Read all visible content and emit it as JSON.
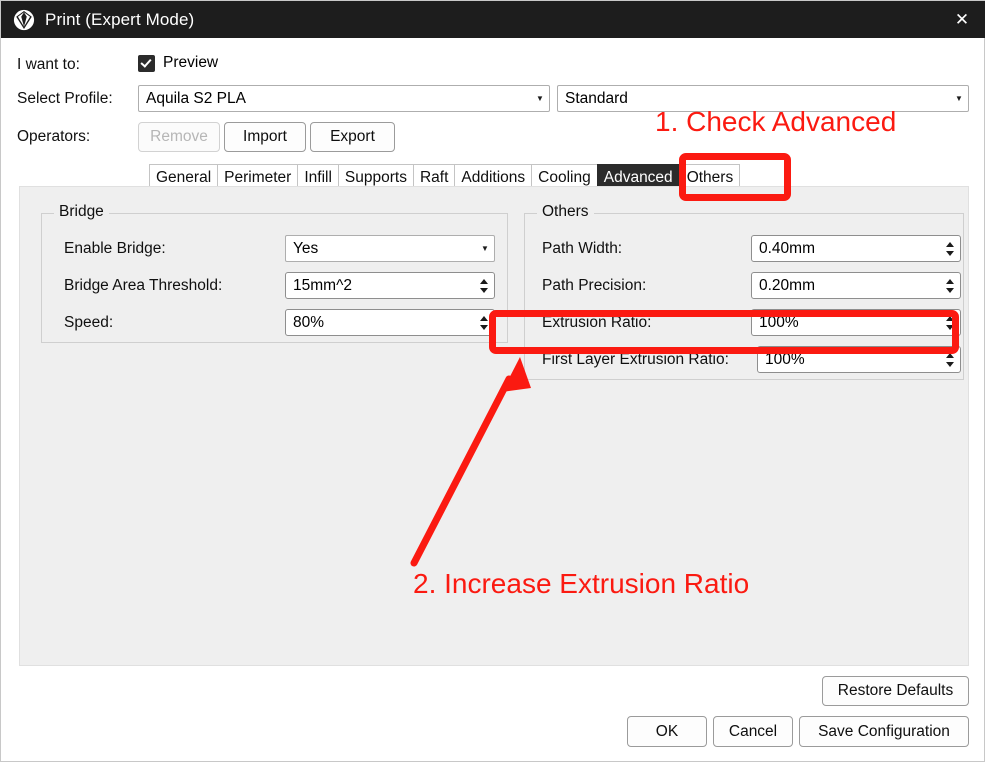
{
  "window": {
    "title": "Print (Expert Mode)",
    "app_icon": "gem-icon",
    "close_icon": "✕"
  },
  "header": {
    "i_want_to_label": "I want to:",
    "preview_label": "Preview",
    "preview_checked": true,
    "select_profile_label": "Select Profile:",
    "profile_value": "Aquila S2 PLA",
    "quality_value": "Standard",
    "operators_label": "Operators:",
    "buttons": [
      {
        "label": "Remove",
        "disabled": true
      },
      {
        "label": "Import",
        "disabled": false
      },
      {
        "label": "Export",
        "disabled": false
      }
    ]
  },
  "tabs": [
    {
      "label": "General",
      "active": false
    },
    {
      "label": "Perimeter",
      "active": false
    },
    {
      "label": "Infill",
      "active": false
    },
    {
      "label": "Supports",
      "active": false
    },
    {
      "label": "Raft",
      "active": false
    },
    {
      "label": "Additions",
      "active": false
    },
    {
      "label": "Cooling",
      "active": false
    },
    {
      "label": "Advanced",
      "active": true
    },
    {
      "label": "Others",
      "active": false
    }
  ],
  "bridge_group": {
    "title": "Bridge",
    "enable_bridge_label": "Enable Bridge:",
    "enable_bridge_value": "Yes",
    "area_threshold_label": "Bridge Area Threshold:",
    "area_threshold_value": "15mm^2",
    "speed_label": "Speed:",
    "speed_value": "80%"
  },
  "others_group": {
    "title": "Others",
    "path_width_label": "Path Width:",
    "path_width_value": "0.40mm",
    "path_precision_label": "Path Precision:",
    "path_precision_value": "0.20mm",
    "extrusion_ratio_label": "Extrusion Ratio:",
    "extrusion_ratio_value": "100%",
    "first_layer_label": "First Layer Extrusion Ratio:",
    "first_layer_value": "100%"
  },
  "footer": {
    "restore_defaults": "Restore Defaults",
    "ok": "OK",
    "cancel": "Cancel",
    "save_configuration": "Save Configuration"
  },
  "annotations": {
    "color": "#fb1a11",
    "step1": "1. Check Advanced",
    "step2": "2. Increase Extrusion Ratio"
  }
}
